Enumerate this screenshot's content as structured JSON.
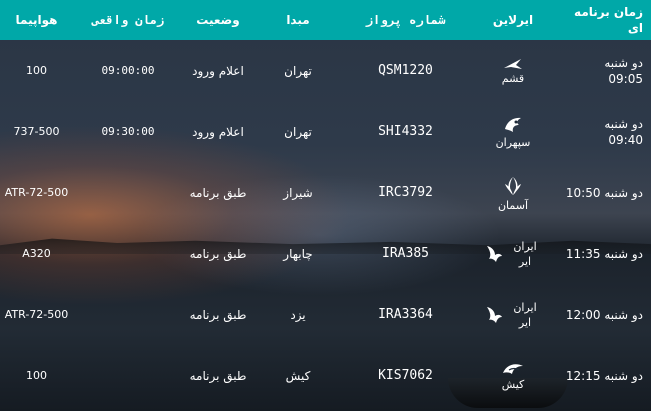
{
  "header": {
    "scheduled_time": "زمان برنامه ای",
    "airline": "ایرلاین",
    "flight_number": "شماره پرواز",
    "origin": "مبدا",
    "status": "وضعیت",
    "actual_time": "زمان واقعی",
    "aircraft": "هواپیما"
  },
  "colors": {
    "header_bg": "#00a8a8",
    "text": "#ffffff"
  },
  "flights": [
    {
      "time_line1": "دو شنبه",
      "time_line2": "09:05",
      "airline_name": "قشم",
      "airline_icon": "qeshm-air-logo-icon",
      "flight": "QSM1220",
      "origin": "تهران",
      "status": "اعلام ورود",
      "actual": "09:00:00",
      "aircraft": "100"
    },
    {
      "time_line1": "دو شنبه",
      "time_line2": "09:40",
      "airline_name": "سپهران",
      "airline_icon": "sepehran-logo-icon",
      "flight": "SHI4332",
      "origin": "تهران",
      "status": "اعلام ورود",
      "actual": "09:30:00",
      "aircraft": "737-500"
    },
    {
      "time_line1": "دو شنبه 10:50",
      "time_line2": "",
      "airline_name": "آسمان",
      "airline_icon": "aseman-logo-icon",
      "flight": "IRC3792",
      "origin": "شیراز",
      "status": "طبق برنامه",
      "actual": "",
      "aircraft": "ATR-72-500"
    },
    {
      "time_line1": "دو شنبه 11:35",
      "time_line2": "",
      "airline_name": "ایران ایر",
      "airline_icon": "iranair-logo-icon",
      "flight": "IRA385",
      "origin": "چابهار",
      "status": "طبق برنامه",
      "actual": "",
      "aircraft": "A320"
    },
    {
      "time_line1": "دو شنبه 12:00",
      "time_line2": "",
      "airline_name": "ایران ایر",
      "airline_icon": "iranair-logo-icon",
      "flight": "IRA3364",
      "origin": "یزد",
      "status": "طبق برنامه",
      "actual": "",
      "aircraft": "ATR-72-500"
    },
    {
      "time_line1": "دو شنبه 12:15",
      "time_line2": "",
      "airline_name": "کیش",
      "airline_icon": "kish-air-logo-icon",
      "flight": "KIS7062",
      "origin": "کیش",
      "status": "طبق برنامه",
      "actual": "",
      "aircraft": "100"
    }
  ]
}
